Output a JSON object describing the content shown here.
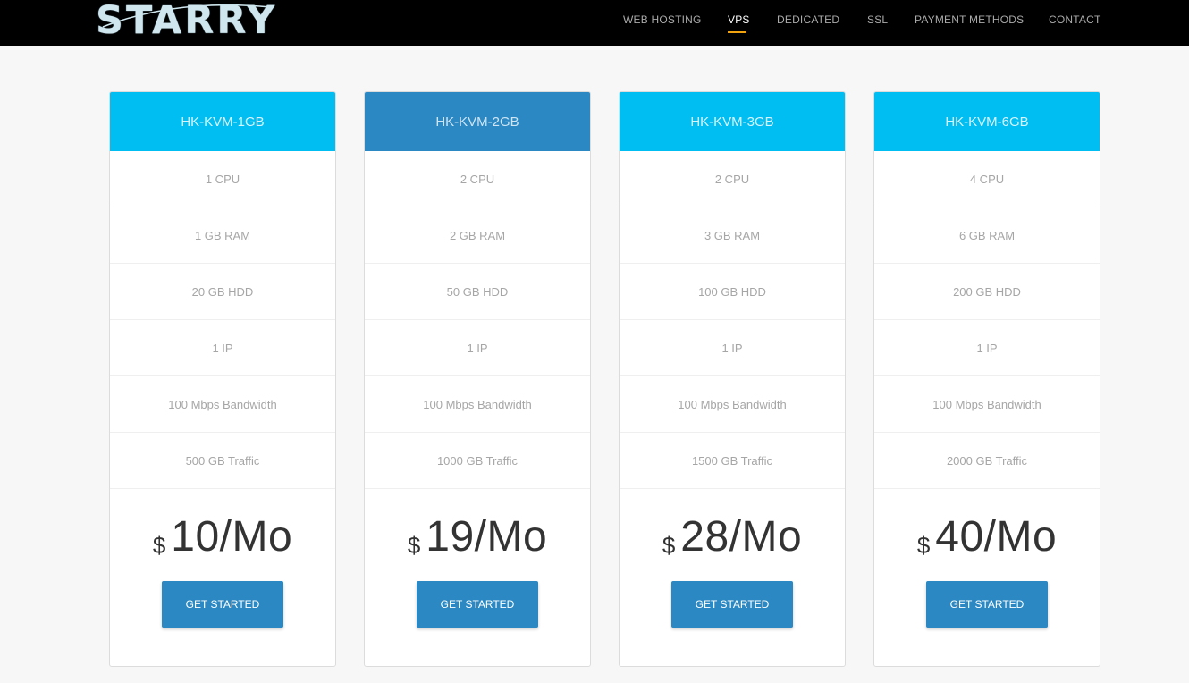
{
  "brand": {
    "logo_text": "STARRY"
  },
  "nav": {
    "items": [
      {
        "label": "WEB HOSTING"
      },
      {
        "label": "VPS",
        "active": true
      },
      {
        "label": "DEDICATED"
      },
      {
        "label": "SSL"
      },
      {
        "label": "PAYMENT METHODS"
      },
      {
        "label": "CONTACT"
      }
    ]
  },
  "colors": {
    "header_light": "#00bdf2",
    "header_featured": "#2b88c2",
    "button": "#2b88c2",
    "nav_active_underline": "#f0a20f"
  },
  "plans": [
    {
      "name": "HK-KVM-1GB",
      "featured": false,
      "features": [
        "1 CPU",
        "1 GB RAM",
        "20 GB HDD",
        "1 IP",
        "100 Mbps Bandwidth",
        "500 GB Traffic"
      ],
      "currency": "$",
      "price": "10/Mo",
      "cta": "GET STARTED"
    },
    {
      "name": "HK-KVM-2GB",
      "featured": true,
      "features": [
        "2 CPU",
        "2 GB RAM",
        "50 GB HDD",
        "1 IP",
        "100 Mbps Bandwidth",
        "1000 GB Traffic"
      ],
      "currency": "$",
      "price": "19/Mo",
      "cta": "GET STARTED"
    },
    {
      "name": "HK-KVM-3GB",
      "featured": false,
      "features": [
        "2 CPU",
        "3 GB RAM",
        "100 GB HDD",
        "1 IP",
        "100 Mbps Bandwidth",
        "1500 GB Traffic"
      ],
      "currency": "$",
      "price": "28/Mo",
      "cta": "GET STARTED"
    },
    {
      "name": "HK-KVM-6GB",
      "featured": false,
      "features": [
        "4 CPU",
        "6 GB RAM",
        "200 GB HDD",
        "1 IP",
        "100 Mbps Bandwidth",
        "2000 GB Traffic"
      ],
      "currency": "$",
      "price": "40/Mo",
      "cta": "GET STARTED"
    }
  ]
}
